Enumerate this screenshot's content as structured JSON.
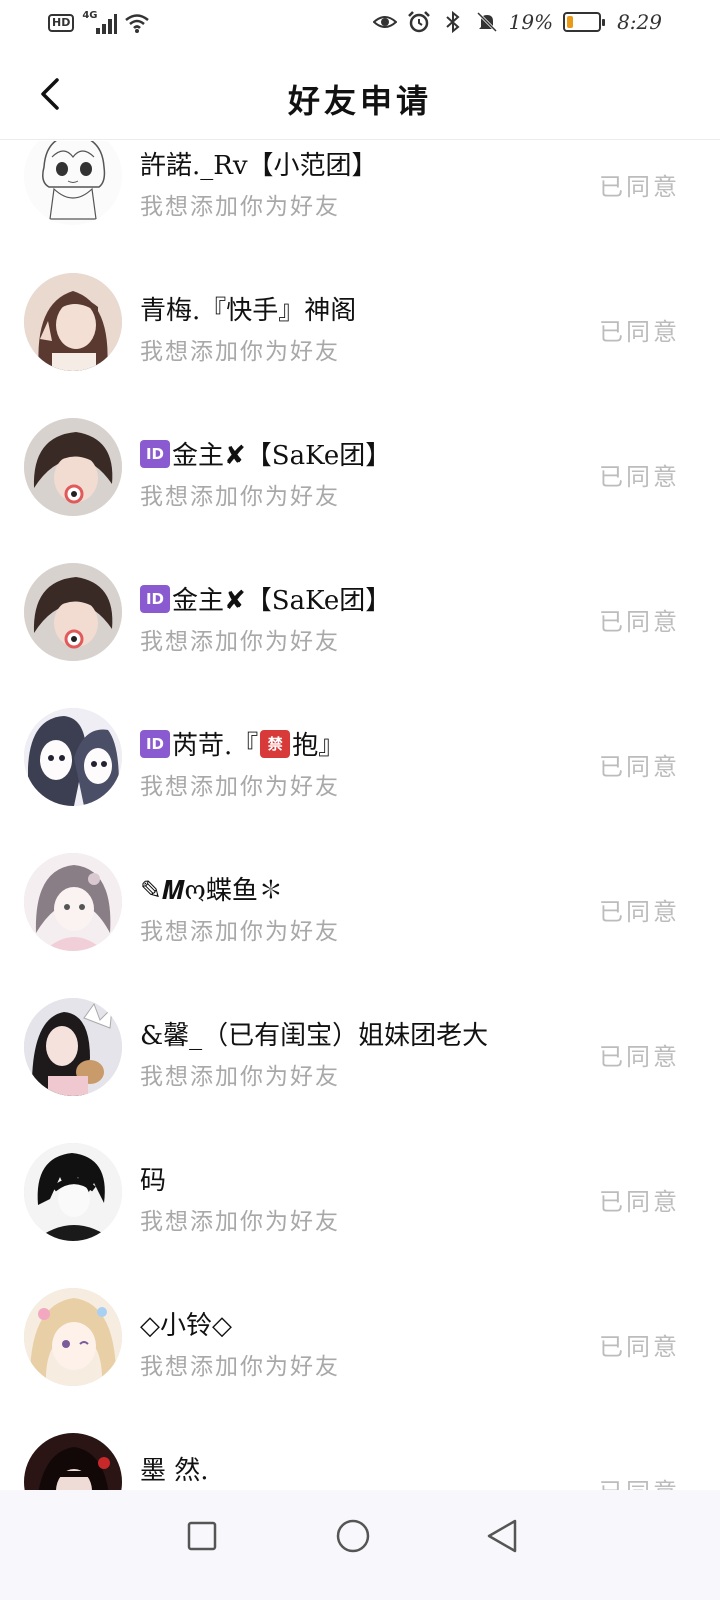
{
  "status_bar": {
    "hd": "HD",
    "network": "4G",
    "battery_text": "19%",
    "battery_level": 0.19,
    "time": "8:29",
    "icons": [
      "eye-icon",
      "alarm-icon",
      "bluetooth-icon",
      "mute-bell-icon"
    ]
  },
  "header": {
    "title": "好友申请",
    "back_icon": "chevron-left-icon"
  },
  "requests": [
    {
      "name": "許諾._Rv【小范团】",
      "message": "我想添加你为好友",
      "status": "已同意"
    },
    {
      "name": "青梅.『快手』神阁",
      "message": "我想添加你为好友",
      "status": "已同意"
    },
    {
      "badge": "ID",
      "name": "金主✘【SaKe团】",
      "message": "我想添加你为好友",
      "status": "已同意"
    },
    {
      "badge": "ID",
      "name": "金主✘【SaKe团】",
      "message": "我想添加你为好友",
      "status": "已同意"
    },
    {
      "badge": "ID",
      "name": "芮苛.『",
      "badge2": "禁",
      "name2": "抱』",
      "message": "我想添加你为好友",
      "status": "已同意"
    },
    {
      "name": "✎𝑴ო蝶鱼✽",
      "message": "我想添加你为好友",
      "status": "已同意"
    },
    {
      "name": "&馨_（已有闺宝）姐妹团老大",
      "message": "我想添加你为好友",
      "status": "已同意"
    },
    {
      "name": "码",
      "message": "我想添加你为好友",
      "status": "已同意"
    },
    {
      "name": "◇小铃◇",
      "message": "我想添加你为好友",
      "status": "已同意"
    },
    {
      "name": "墨 然.",
      "message": "",
      "status": "已同意"
    }
  ],
  "system_nav": {
    "icons": [
      "recent-apps-icon",
      "home-icon",
      "back-triangle-icon"
    ]
  },
  "colors": {
    "badge_purple": "#8a5ad0",
    "badge_red": "#d83a3a",
    "status_gray": "#bcbcbc",
    "message_gray": "#a8a8a8",
    "battery_fill": "#e89a1a"
  }
}
